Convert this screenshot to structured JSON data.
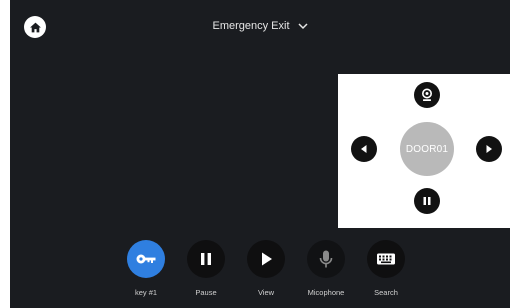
{
  "header": {
    "title": "Emergency Exit",
    "title_chevron_icon": "chevron-down-icon",
    "home_icon": "home-icon"
  },
  "ptz": {
    "center_label": "DOOR01",
    "up_icon": "webcam-icon",
    "left_icon": "triangle-left-icon",
    "right_icon": "triangle-right-icon",
    "down_icon": "pause-icon"
  },
  "toolbar": {
    "items": [
      {
        "label": "key #1",
        "icon": "key-icon",
        "state": "active"
      },
      {
        "label": "Pause",
        "icon": "pause-icon",
        "state": "normal"
      },
      {
        "label": "View",
        "icon": "play-icon",
        "state": "normal"
      },
      {
        "label": "Micophone",
        "icon": "microphone-icon",
        "state": "disabled"
      },
      {
        "label": "Search",
        "icon": "keyboard-icon",
        "state": "normal"
      }
    ]
  },
  "colors": {
    "background": "#1a1c20",
    "accent": "#2f7fe0",
    "panel": "#ffffff",
    "ptz_center": "#b9b9b9"
  }
}
